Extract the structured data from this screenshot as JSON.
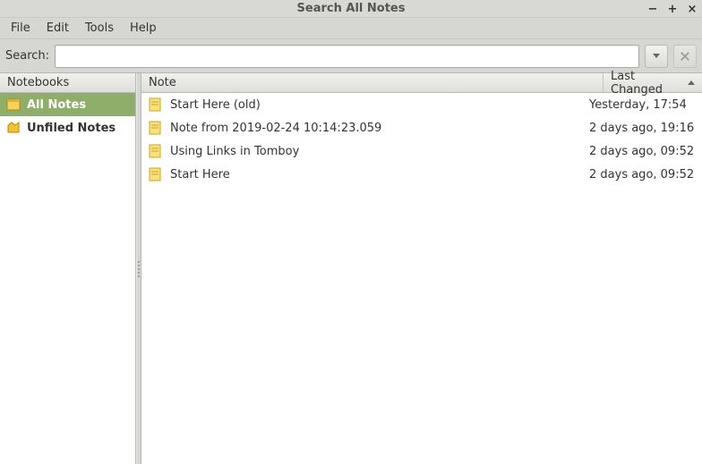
{
  "window": {
    "title": "Search All Notes"
  },
  "menu": {
    "file": "File",
    "edit": "Edit",
    "tools": "Tools",
    "help": "Help"
  },
  "search": {
    "label": "Search:",
    "value": ""
  },
  "sidebar": {
    "header": "Notebooks",
    "items": [
      {
        "label": "All Notes",
        "selected": true
      },
      {
        "label": "Unfiled Notes",
        "selected": false
      }
    ]
  },
  "columns": {
    "note": "Note",
    "changed": "Last Changed"
  },
  "notes": [
    {
      "name": "Start Here (old)",
      "changed": "Yesterday, 17:54"
    },
    {
      "name": "Note from 2019-02-24 10:14:23.059",
      "changed": "2 days ago, 19:16"
    },
    {
      "name": "Using Links in Tomboy",
      "changed": "2 days ago, 09:52"
    },
    {
      "name": "Start Here",
      "changed": "2 days ago, 09:52"
    }
  ]
}
